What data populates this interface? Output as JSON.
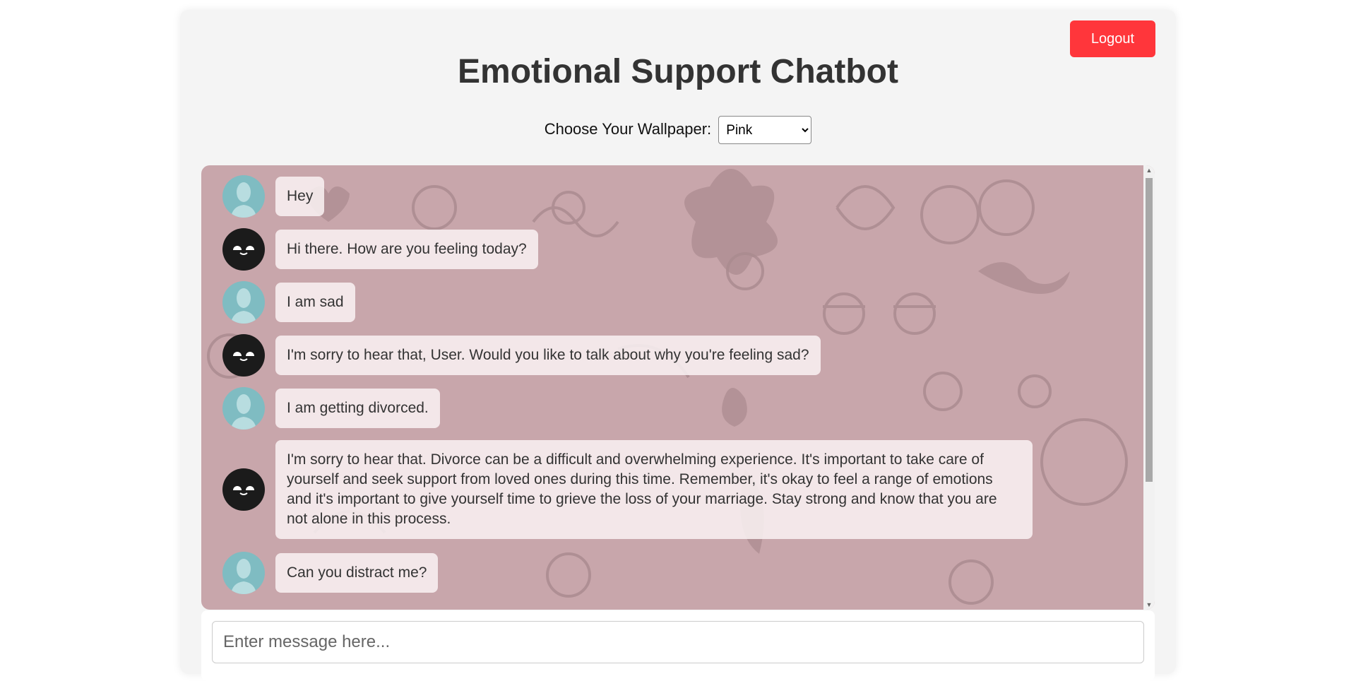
{
  "header": {
    "title": "Emotional Support Chatbot",
    "logout_label": "Logout"
  },
  "wallpaper": {
    "label": "Choose Your Wallpaper:",
    "selected": "Pink"
  },
  "colors": {
    "chat_bg": "#c8a6ab",
    "logout": "#ff363b",
    "user_avatar": "#7fbcc2",
    "bot_avatar": "#1b1b1b"
  },
  "messages": [
    {
      "sender": "user",
      "text": "Hey"
    },
    {
      "sender": "bot",
      "text": "Hi there. How are you feeling today?"
    },
    {
      "sender": "user",
      "text": "I am sad"
    },
    {
      "sender": "bot",
      "text": "I'm sorry to hear that, User. Would you like to talk about why you're feeling sad?"
    },
    {
      "sender": "user",
      "text": "I am getting divorced."
    },
    {
      "sender": "bot",
      "text": "I'm sorry to hear that. Divorce can be a difficult and overwhelming experience. It's important to take care of yourself and seek support from loved ones during this time. Remember, it's okay to feel a range of emotions and it's important to give yourself time to grieve the loss of your marriage. Stay strong and know that you are not alone in this process."
    },
    {
      "sender": "user",
      "text": "Can you distract me?"
    }
  ],
  "input": {
    "placeholder": "Enter message here...",
    "value": ""
  }
}
